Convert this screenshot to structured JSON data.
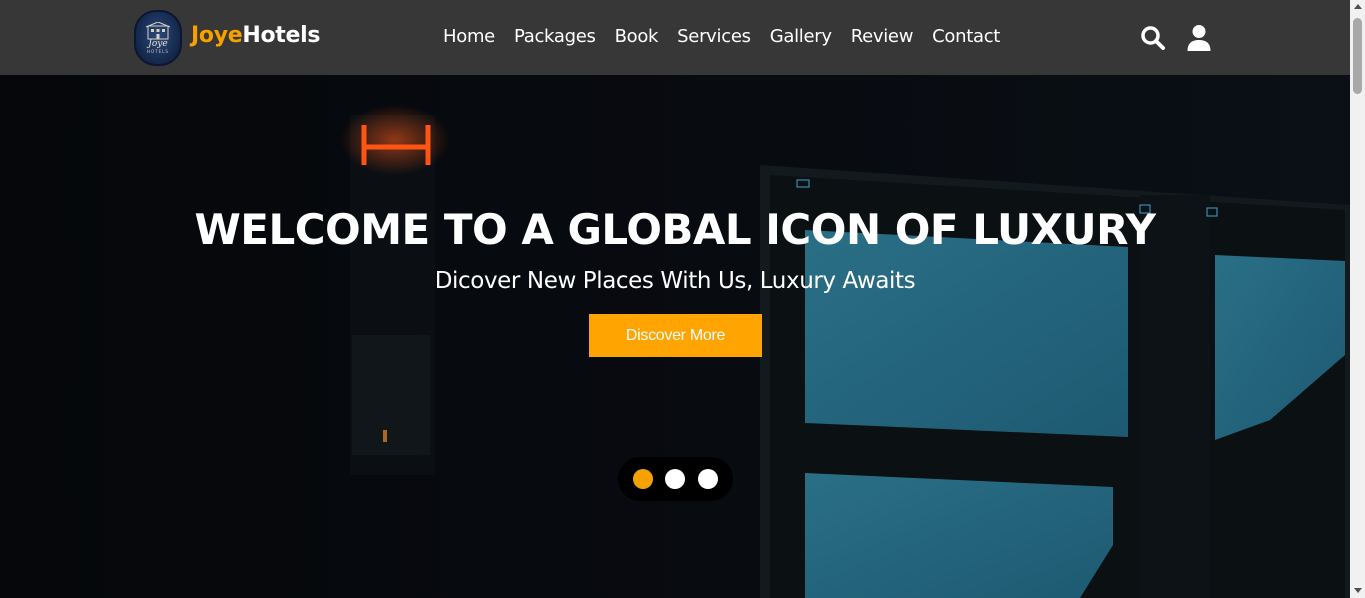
{
  "brand": {
    "part1": "Joye",
    "part2": "Hotels",
    "logo_text": "Joye",
    "logo_sub": "HOTELS"
  },
  "nav": {
    "items": [
      {
        "label": "Home"
      },
      {
        "label": "Packages"
      },
      {
        "label": "Book"
      },
      {
        "label": "Services"
      },
      {
        "label": "Gallery"
      },
      {
        "label": "Review"
      },
      {
        "label": "Contact"
      }
    ]
  },
  "header_icons": {
    "search": "search-icon",
    "user": "user-icon"
  },
  "hero": {
    "title": "WELCOME TO A GLOBAL ICON OF LUXURY",
    "subtitle": "Dicover New Places With Us, Luxury Awaits",
    "button_label": "Discover More",
    "slides": {
      "count": 3,
      "active": 1
    }
  },
  "colors": {
    "accent": "#f5a100",
    "button": "#ffa400",
    "header_bg": "#373737",
    "hero_bg": "#07090d"
  }
}
